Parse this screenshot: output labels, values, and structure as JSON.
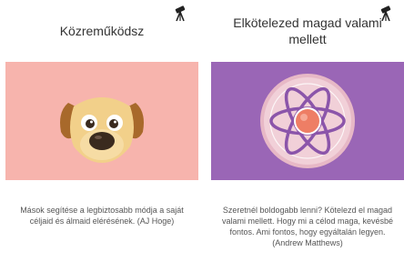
{
  "cards": [
    {
      "title": "Közreműködsz",
      "quote": "Mások segítése a legbiztosabb módja a saját céljaid és álmaid elérésének. (AJ Hoge)",
      "media_color": "#f7b4ad",
      "illustration": "dog-face",
      "corner_icon": "telescope-icon"
    },
    {
      "title": "Elkötelezed magad valami mellett",
      "quote": "Szeretnél boldogabb lenni? Kötelezd el magad valami mellett. Hogy mi a célod maga, kevésbé fontos. Ami fontos, hogy egyáltalán legyen. (Andrew Matthews)",
      "media_color": "#9a66b6",
      "illustration": "atom",
      "corner_icon": "telescope-icon"
    }
  ]
}
